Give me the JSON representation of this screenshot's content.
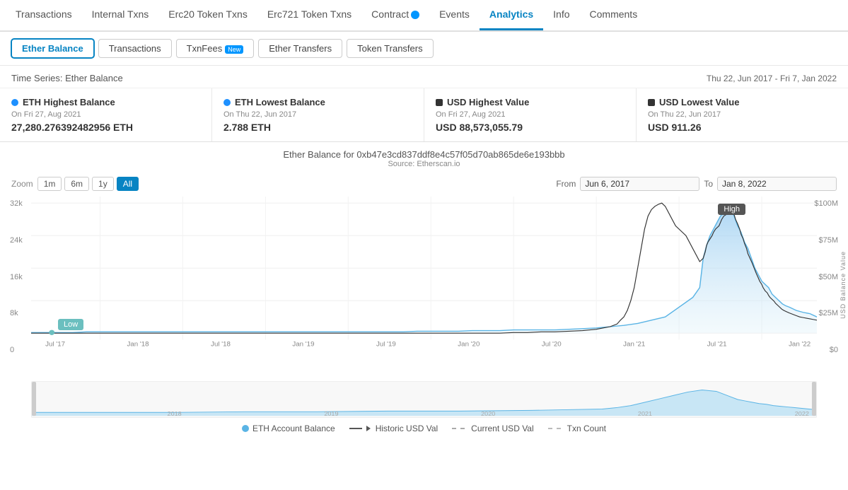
{
  "nav": {
    "items": [
      {
        "label": "Transactions",
        "active": false
      },
      {
        "label": "Internal Txns",
        "active": false
      },
      {
        "label": "Erc20 Token Txns",
        "active": false
      },
      {
        "label": "Erc721 Token Txns",
        "active": false
      },
      {
        "label": "Contract",
        "active": false,
        "has_icon": true
      },
      {
        "label": "Events",
        "active": false
      },
      {
        "label": "Analytics",
        "active": true
      },
      {
        "label": "Info",
        "active": false
      },
      {
        "label": "Comments",
        "active": false
      }
    ]
  },
  "subnav": {
    "buttons": [
      {
        "label": "Ether Balance",
        "active": true
      },
      {
        "label": "Transactions",
        "active": false
      },
      {
        "label": "TxnFees",
        "active": false,
        "badge": "New"
      },
      {
        "label": "Ether Transfers",
        "active": false
      },
      {
        "label": "Token Transfers",
        "active": false
      }
    ]
  },
  "timeseries": {
    "title": "Time Series: Ether Balance",
    "range": "Thu 22, Jun 2017 - Fri 7, Jan 2022"
  },
  "stats": [
    {
      "type": "blue",
      "label": "ETH Highest Balance",
      "date": "On Fri 27, Aug 2021",
      "value": "27,280.276392482956 ETH"
    },
    {
      "type": "blue",
      "label": "ETH Lowest Balance",
      "date": "On Thu 22, Jun 2017",
      "value": "2.788 ETH"
    },
    {
      "type": "dark",
      "label": "USD Highest Value",
      "date": "On Fri 27, Aug 2021",
      "value": "USD 88,573,055.79"
    },
    {
      "type": "dark",
      "label": "USD Lowest Value",
      "date": "On Thu 22, Jun 2017",
      "value": "USD 911.26"
    }
  ],
  "chart": {
    "title": "Ether Balance for 0xb47e3cd837ddf8e4c57f05d70ab865de6e193bbb",
    "source": "Source: Etherscan.io",
    "zoom_label": "Zoom",
    "zoom_options": [
      "1m",
      "6m",
      "1y",
      "All"
    ],
    "zoom_active": "All",
    "from_label": "From",
    "from_date": "Jun 6, 2017",
    "to_label": "To",
    "to_date": "Jan 8, 2022",
    "y_labels_left": [
      "32k",
      "24k",
      "16k",
      "8k",
      "0"
    ],
    "y_labels_right": [
      "$100M",
      "$75M",
      "$50M",
      "$25M",
      "$0"
    ],
    "x_labels": [
      "Jul '17",
      "Jan '18",
      "Jul '18",
      "Jan '19",
      "Jul '19",
      "Jan '20",
      "Jul '20",
      "Jan '21",
      "Jul '21",
      "Jan '22"
    ],
    "high_label": "High",
    "low_label": "Low",
    "usd_axis_label": "USD Balance Value"
  },
  "legend": {
    "items": [
      {
        "label": "ETH Account Balance",
        "type": "dot",
        "color": "#5ab4e5"
      },
      {
        "label": "Historic USD Val",
        "type": "arrow-line",
        "color": "#555"
      },
      {
        "label": "Current USD Val",
        "type": "dashed",
        "color": "#aaa"
      },
      {
        "label": "Txn Count",
        "type": "dashed2",
        "color": "#bbb"
      }
    ]
  },
  "mini_chart": {
    "years": [
      "2018",
      "2019",
      "2020",
      "2021",
      "2022"
    ]
  }
}
